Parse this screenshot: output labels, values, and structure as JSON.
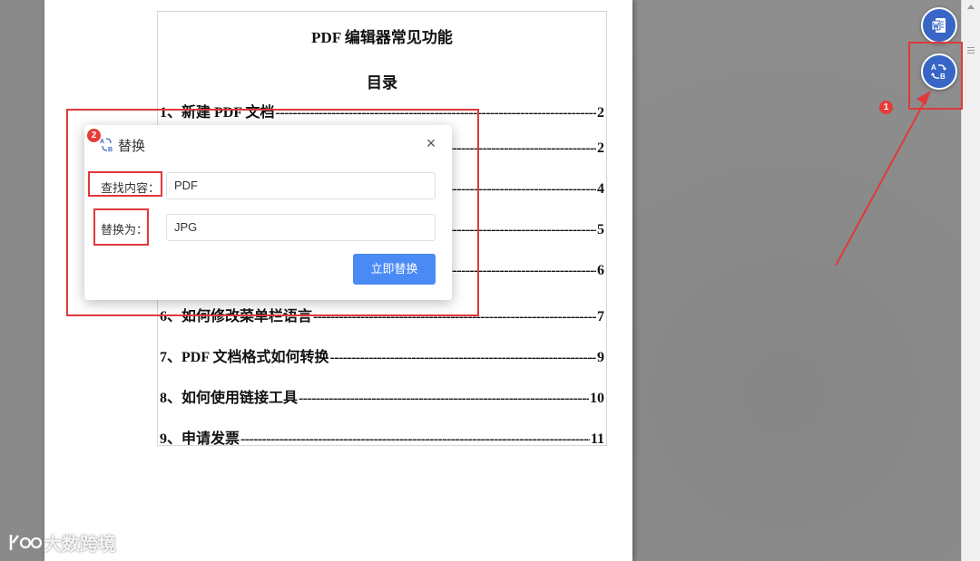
{
  "document": {
    "title": "PDF 编辑器常见功能",
    "subtitle": "目录",
    "toc": [
      {
        "label": "1、新建 PDF 文档",
        "page": "2"
      },
      {
        "label": "",
        "page": "2"
      },
      {
        "label": "",
        "page": "4"
      },
      {
        "label": "",
        "page": "5"
      },
      {
        "label": "",
        "page": "6"
      },
      {
        "label": "6、如何修改菜单栏语言",
        "page": "7"
      },
      {
        "label": "7、PDF 文档格式如何转换",
        "page": "9"
      },
      {
        "label": "8、如何使用链接工具",
        "page": "10"
      },
      {
        "label": "9、申请发票",
        "page": "11"
      }
    ]
  },
  "dialog": {
    "title": "替换",
    "find_label": "查找内容：",
    "find_value": "PDF",
    "replace_label": "替换为：",
    "replace_value": "JPG",
    "submit_label": "立即替换"
  },
  "sidebar_tools": [
    {
      "icon": "word-convert-icon"
    },
    {
      "icon": "replace-icon"
    }
  ],
  "annotations": [
    {
      "badge": "1"
    },
    {
      "badge": "2"
    }
  ],
  "watermark": {
    "text": "大数跨境"
  },
  "colors": {
    "accent": "#3866c7",
    "button": "#4a8af4",
    "annotation": "#e0393b"
  }
}
